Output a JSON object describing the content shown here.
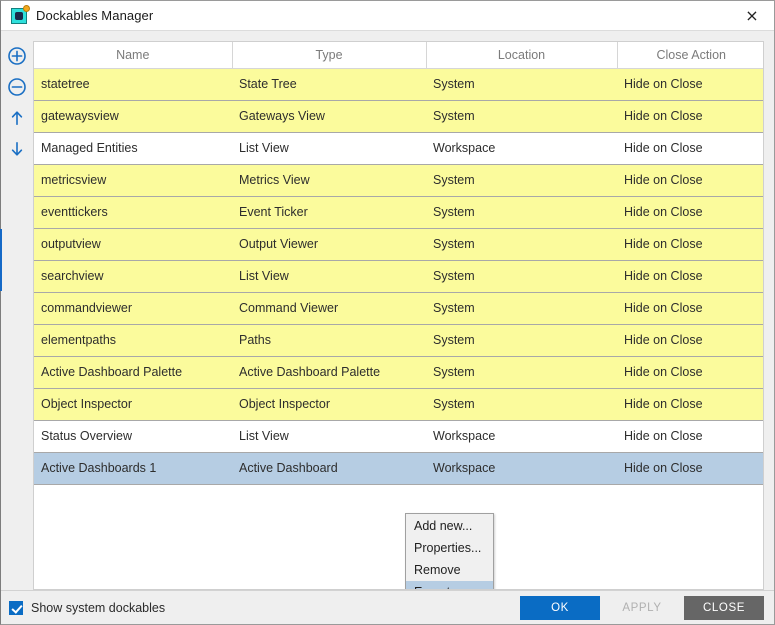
{
  "window": {
    "title": "Dockables Manager",
    "icon": "camera-dockable-icon",
    "close_label": "×"
  },
  "toolbar": {
    "items": [
      {
        "name": "add-dockable-button",
        "icon": "plus-circle-icon"
      },
      {
        "name": "remove-dockable-button",
        "icon": "minus-circle-icon"
      },
      {
        "name": "move-up-button",
        "icon": "arrow-up-icon"
      },
      {
        "name": "move-down-button",
        "icon": "arrow-down-icon"
      }
    ]
  },
  "table": {
    "columns": [
      "Name",
      "Type",
      "Location",
      "Close Action"
    ],
    "rows": [
      {
        "name": "statetree",
        "type": "State Tree",
        "location": "System",
        "close_action": "Hide on Close",
        "kind": "sys"
      },
      {
        "name": "gatewaysview",
        "type": "Gateways View",
        "location": "System",
        "close_action": "Hide on Close",
        "kind": "sys"
      },
      {
        "name": "Managed Entities",
        "type": "List View",
        "location": "Workspace",
        "close_action": "Hide on Close",
        "kind": "user"
      },
      {
        "name": "metricsview",
        "type": "Metrics View",
        "location": "System",
        "close_action": "Hide on Close",
        "kind": "sys"
      },
      {
        "name": "eventtickers",
        "type": "Event Ticker",
        "location": "System",
        "close_action": "Hide on Close",
        "kind": "sys"
      },
      {
        "name": "outputview",
        "type": "Output Viewer",
        "location": "System",
        "close_action": "Hide on Close",
        "kind": "sys"
      },
      {
        "name": "searchview",
        "type": "List View",
        "location": "System",
        "close_action": "Hide on Close",
        "kind": "sys"
      },
      {
        "name": "commandviewer",
        "type": "Command Viewer",
        "location": "System",
        "close_action": "Hide on Close",
        "kind": "sys"
      },
      {
        "name": "elementpaths",
        "type": "Paths",
        "location": "System",
        "close_action": "Hide on Close",
        "kind": "sys"
      },
      {
        "name": "Active Dashboard Palette",
        "type": "Active Dashboard Palette",
        "location": "System",
        "close_action": "Hide on Close",
        "kind": "sys"
      },
      {
        "name": "Object Inspector",
        "type": "Object Inspector",
        "location": "System",
        "close_action": "Hide on Close",
        "kind": "sys"
      },
      {
        "name": "Status Overview",
        "type": "List View",
        "location": "Workspace",
        "close_action": "Hide on Close",
        "kind": "user"
      },
      {
        "name": "Active Dashboards 1",
        "type": "Active Dashboard",
        "location": "Workspace",
        "close_action": "Hide on Close",
        "kind": "sel"
      }
    ]
  },
  "context_menu": {
    "items": [
      {
        "label": "Add new...",
        "highlighted": false
      },
      {
        "label": "Properties...",
        "highlighted": false
      },
      {
        "label": "Remove",
        "highlighted": false
      },
      {
        "label": "Export...",
        "highlighted": true
      }
    ]
  },
  "footer": {
    "checkbox_label": "Show system dockables",
    "checkbox_checked": true,
    "buttons": [
      {
        "label": "OK",
        "style": "primary",
        "name": "ok-button"
      },
      {
        "label": "APPLY",
        "style": "disabled",
        "name": "apply-button"
      },
      {
        "label": "CLOSE",
        "style": "dark",
        "name": "close-button"
      }
    ]
  },
  "colors": {
    "system_row": "#fbfb9c",
    "selected_row": "#b6cde3",
    "accent": "#0a6cc4",
    "icon_blue": "#1a6fc4"
  }
}
